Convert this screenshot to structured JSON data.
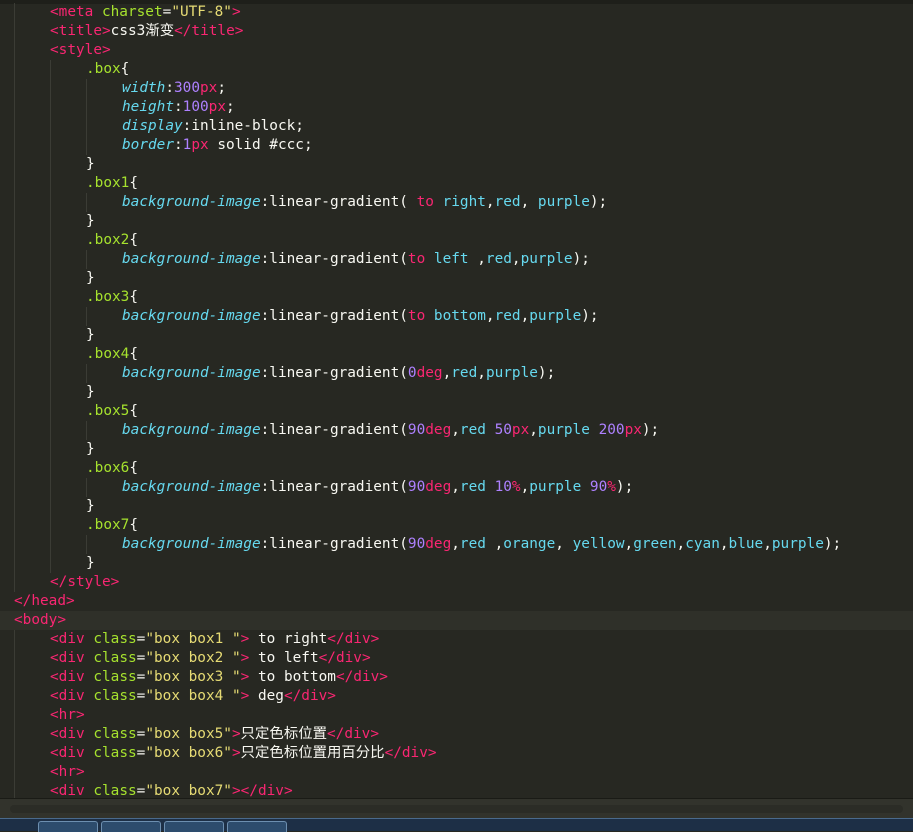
{
  "editor": {
    "lines": [
      {
        "indent": 1,
        "tokens": [
          [
            "tag",
            "<meta "
          ],
          [
            "attr",
            "charset"
          ],
          [
            "punct",
            "="
          ],
          [
            "str",
            "\"UTF-8\""
          ],
          [
            "tag",
            ">"
          ]
        ]
      },
      {
        "indent": 1,
        "tokens": [
          [
            "tag",
            "<title>"
          ],
          [
            "text",
            "css3渐变"
          ],
          [
            "tag",
            "</title>"
          ]
        ]
      },
      {
        "indent": 1,
        "tokens": [
          [
            "tag",
            "<style>"
          ]
        ]
      },
      {
        "indent": 2,
        "tokens": [
          [
            "sel",
            ".box"
          ],
          [
            "punct",
            "{"
          ]
        ]
      },
      {
        "indent": 3,
        "tokens": [
          [
            "prop",
            "width"
          ],
          [
            "punct",
            ":"
          ],
          [
            "num",
            "300"
          ],
          [
            "unit",
            "px"
          ],
          [
            "punct",
            ";"
          ]
        ]
      },
      {
        "indent": 3,
        "tokens": [
          [
            "prop",
            "height"
          ],
          [
            "punct",
            ":"
          ],
          [
            "num",
            "100"
          ],
          [
            "unit",
            "px"
          ],
          [
            "punct",
            ";"
          ]
        ]
      },
      {
        "indent": 3,
        "tokens": [
          [
            "prop",
            "display"
          ],
          [
            "punct",
            ":"
          ],
          [
            "text",
            "inline-block"
          ],
          [
            "punct",
            ";"
          ]
        ]
      },
      {
        "indent": 3,
        "tokens": [
          [
            "prop",
            "border"
          ],
          [
            "punct",
            ":"
          ],
          [
            "num",
            "1"
          ],
          [
            "unit",
            "px"
          ],
          [
            "text",
            " solid #ccc"
          ],
          [
            "punct",
            ";"
          ]
        ]
      },
      {
        "indent": 2,
        "tokens": [
          [
            "punct",
            "}"
          ]
        ]
      },
      {
        "indent": 2,
        "tokens": [
          [
            "sel",
            ".box1"
          ],
          [
            "punct",
            "{"
          ]
        ]
      },
      {
        "indent": 3,
        "tokens": [
          [
            "prop",
            "background-image"
          ],
          [
            "punct",
            ":"
          ],
          [
            "text",
            "linear-gradient( "
          ],
          [
            "kw",
            "to"
          ],
          [
            "val",
            " right"
          ],
          [
            "punct",
            ","
          ],
          [
            "val",
            "red"
          ],
          [
            "punct",
            ", "
          ],
          [
            "val",
            "purple"
          ],
          [
            "punct",
            ");"
          ]
        ]
      },
      {
        "indent": 2,
        "tokens": [
          [
            "punct",
            "}"
          ]
        ]
      },
      {
        "indent": 2,
        "tokens": [
          [
            "sel",
            ".box2"
          ],
          [
            "punct",
            "{"
          ]
        ]
      },
      {
        "indent": 3,
        "tokens": [
          [
            "prop",
            "background-image"
          ],
          [
            "punct",
            ":"
          ],
          [
            "text",
            "linear-gradient("
          ],
          [
            "kw",
            "to"
          ],
          [
            "val",
            " left "
          ],
          [
            "punct",
            ","
          ],
          [
            "val",
            "red"
          ],
          [
            "punct",
            ","
          ],
          [
            "val",
            "purple"
          ],
          [
            "punct",
            ");"
          ]
        ]
      },
      {
        "indent": 2,
        "tokens": [
          [
            "punct",
            "}"
          ]
        ]
      },
      {
        "indent": 2,
        "tokens": [
          [
            "sel",
            ".box3"
          ],
          [
            "punct",
            "{"
          ]
        ]
      },
      {
        "indent": 3,
        "tokens": [
          [
            "prop",
            "background-image"
          ],
          [
            "punct",
            ":"
          ],
          [
            "text",
            "linear-gradient("
          ],
          [
            "kw",
            "to"
          ],
          [
            "val",
            " bottom"
          ],
          [
            "punct",
            ","
          ],
          [
            "val",
            "red"
          ],
          [
            "punct",
            ","
          ],
          [
            "val",
            "purple"
          ],
          [
            "punct",
            ");"
          ]
        ]
      },
      {
        "indent": 2,
        "tokens": [
          [
            "punct",
            "}"
          ]
        ]
      },
      {
        "indent": 2,
        "tokens": [
          [
            "sel",
            ".box4"
          ],
          [
            "punct",
            "{"
          ]
        ]
      },
      {
        "indent": 3,
        "tokens": [
          [
            "prop",
            "background-image"
          ],
          [
            "punct",
            ":"
          ],
          [
            "text",
            "linear-gradient("
          ],
          [
            "num",
            "0"
          ],
          [
            "unit",
            "deg"
          ],
          [
            "punct",
            ","
          ],
          [
            "val",
            "red"
          ],
          [
            "punct",
            ","
          ],
          [
            "val",
            "purple"
          ],
          [
            "punct",
            ");"
          ]
        ]
      },
      {
        "indent": 2,
        "tokens": [
          [
            "punct",
            "}"
          ]
        ]
      },
      {
        "indent": 2,
        "tokens": [
          [
            "sel",
            ".box5"
          ],
          [
            "punct",
            "{"
          ]
        ]
      },
      {
        "indent": 3,
        "tokens": [
          [
            "prop",
            "background-image"
          ],
          [
            "punct",
            ":"
          ],
          [
            "text",
            "linear-gradient("
          ],
          [
            "num",
            "90"
          ],
          [
            "unit",
            "deg"
          ],
          [
            "punct",
            ","
          ],
          [
            "val",
            "red "
          ],
          [
            "num",
            "50"
          ],
          [
            "unit",
            "px"
          ],
          [
            "punct",
            ","
          ],
          [
            "val",
            "purple "
          ],
          [
            "num",
            "200"
          ],
          [
            "unit",
            "px"
          ],
          [
            "punct",
            ");"
          ]
        ]
      },
      {
        "indent": 2,
        "tokens": [
          [
            "punct",
            "}"
          ]
        ]
      },
      {
        "indent": 2,
        "tokens": [
          [
            "sel",
            ".box6"
          ],
          [
            "punct",
            "{"
          ]
        ]
      },
      {
        "indent": 3,
        "tokens": [
          [
            "prop",
            "background-image"
          ],
          [
            "punct",
            ":"
          ],
          [
            "text",
            "linear-gradient("
          ],
          [
            "num",
            "90"
          ],
          [
            "unit",
            "deg"
          ],
          [
            "punct",
            ","
          ],
          [
            "val",
            "red "
          ],
          [
            "num",
            "10"
          ],
          [
            "unit",
            "%"
          ],
          [
            "punct",
            ","
          ],
          [
            "val",
            "purple "
          ],
          [
            "num",
            "90"
          ],
          [
            "unit",
            "%"
          ],
          [
            "punct",
            ");"
          ]
        ]
      },
      {
        "indent": 2,
        "tokens": [
          [
            "punct",
            "}"
          ]
        ]
      },
      {
        "indent": 2,
        "tokens": [
          [
            "sel",
            ".box7"
          ],
          [
            "punct",
            "{"
          ]
        ]
      },
      {
        "indent": 3,
        "tokens": [
          [
            "prop",
            "background-image"
          ],
          [
            "punct",
            ":"
          ],
          [
            "text",
            "linear-gradient("
          ],
          [
            "num",
            "90"
          ],
          [
            "unit",
            "deg"
          ],
          [
            "punct",
            ","
          ],
          [
            "val",
            "red "
          ],
          [
            "punct",
            ","
          ],
          [
            "val",
            "orange"
          ],
          [
            "punct",
            ", "
          ],
          [
            "val",
            "yellow"
          ],
          [
            "punct",
            ","
          ],
          [
            "val",
            "green"
          ],
          [
            "punct",
            ","
          ],
          [
            "val",
            "cyan"
          ],
          [
            "punct",
            ","
          ],
          [
            "val",
            "blue"
          ],
          [
            "punct",
            ","
          ],
          [
            "val",
            "purple"
          ],
          [
            "punct",
            ");"
          ]
        ]
      },
      {
        "indent": 2,
        "tokens": [
          [
            "punct",
            "}"
          ]
        ]
      },
      {
        "indent": 1,
        "tokens": [
          [
            "tag",
            "</style>"
          ]
        ]
      },
      {
        "indent": 0,
        "tokens": [
          [
            "tag",
            "</head>"
          ]
        ]
      },
      {
        "indent": 0,
        "active": true,
        "tokens": [
          [
            "tag",
            "<body>"
          ]
        ]
      },
      {
        "indent": 1,
        "tokens": [
          [
            "tag",
            "<div "
          ],
          [
            "attr",
            "class"
          ],
          [
            "punct",
            "="
          ],
          [
            "str",
            "\"box box1 \""
          ],
          [
            "tag",
            ">"
          ],
          [
            "text",
            " to right"
          ],
          [
            "tag",
            "</div>"
          ]
        ]
      },
      {
        "indent": 1,
        "tokens": [
          [
            "tag",
            "<div "
          ],
          [
            "attr",
            "class"
          ],
          [
            "punct",
            "="
          ],
          [
            "str",
            "\"box box2 \""
          ],
          [
            "tag",
            ">"
          ],
          [
            "text",
            " to left"
          ],
          [
            "tag",
            "</div>"
          ]
        ]
      },
      {
        "indent": 1,
        "tokens": [
          [
            "tag",
            "<div "
          ],
          [
            "attr",
            "class"
          ],
          [
            "punct",
            "="
          ],
          [
            "str",
            "\"box box3 \""
          ],
          [
            "tag",
            ">"
          ],
          [
            "text",
            " to bottom"
          ],
          [
            "tag",
            "</div>"
          ]
        ]
      },
      {
        "indent": 1,
        "tokens": [
          [
            "tag",
            "<div "
          ],
          [
            "attr",
            "class"
          ],
          [
            "punct",
            "="
          ],
          [
            "str",
            "\"box box4 \""
          ],
          [
            "tag",
            ">"
          ],
          [
            "text",
            " deg"
          ],
          [
            "tag",
            "</div>"
          ]
        ]
      },
      {
        "indent": 1,
        "tokens": [
          [
            "tag",
            "<hr>"
          ]
        ]
      },
      {
        "indent": 1,
        "tokens": [
          [
            "tag",
            "<div "
          ],
          [
            "attr",
            "class"
          ],
          [
            "punct",
            "="
          ],
          [
            "str",
            "\"box box5\""
          ],
          [
            "tag",
            ">"
          ],
          [
            "text",
            "只定色标位置"
          ],
          [
            "tag",
            "</div>"
          ]
        ]
      },
      {
        "indent": 1,
        "tokens": [
          [
            "tag",
            "<div "
          ],
          [
            "attr",
            "class"
          ],
          [
            "punct",
            "="
          ],
          [
            "str",
            "\"box box6\""
          ],
          [
            "tag",
            ">"
          ],
          [
            "text",
            "只定色标位置用百分比"
          ],
          [
            "tag",
            "</div>"
          ]
        ]
      },
      {
        "indent": 1,
        "tokens": [
          [
            "tag",
            "<hr>"
          ]
        ]
      },
      {
        "indent": 1,
        "tokens": [
          [
            "tag",
            "<div "
          ],
          [
            "attr",
            "class"
          ],
          [
            "punct",
            "="
          ],
          [
            "str",
            "\"box box7\""
          ],
          [
            "tag",
            "></div>"
          ]
        ]
      }
    ]
  },
  "taskbar": {
    "items": [
      "ie-icon",
      "folder-icon",
      "chrome-icon",
      "app-icon"
    ]
  },
  "colors": {
    "background": "#272822",
    "tag": "#f92672",
    "attr": "#a6e22e",
    "string": "#e6db74",
    "property": "#66d9ef",
    "number": "#ae81ff"
  }
}
